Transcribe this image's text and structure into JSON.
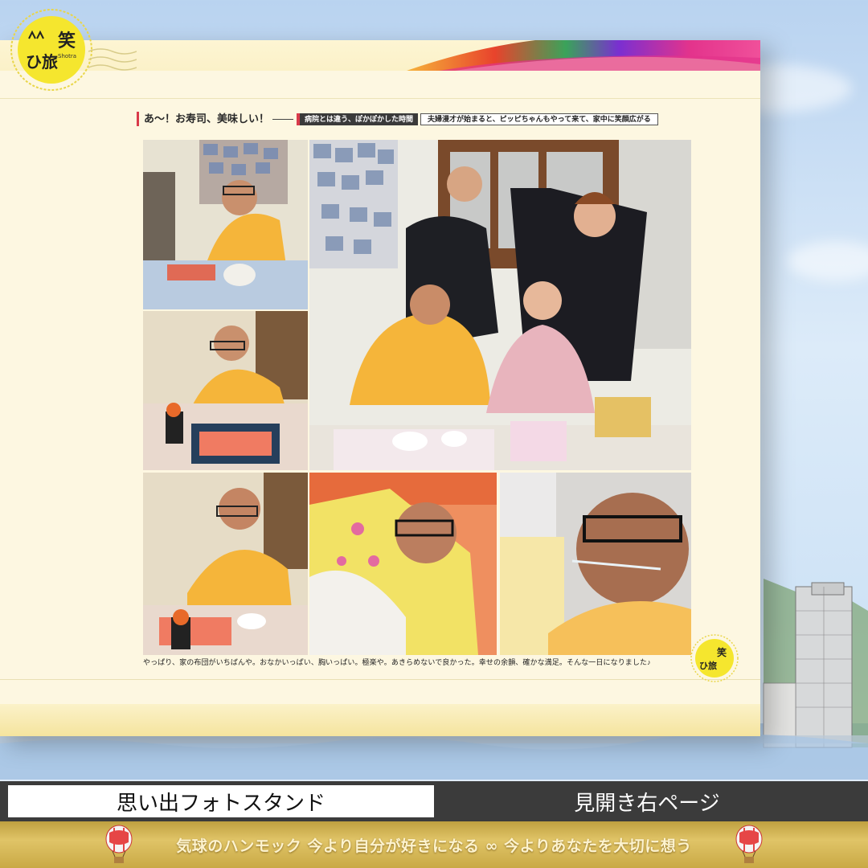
{
  "brand": {
    "logo_text_top": "笑",
    "logo_text_bottom": "ひ旅",
    "logo_sub": "Shotra",
    "accent_yellow": "#f5e62e"
  },
  "page": {
    "heading_title": "あ〜！お寿司、美味しい！",
    "heading_sub": "病院とは違う、ぽかぽかした時間",
    "heading_desc": "夫婦漫才が始まると、ピッピちゃんもやって来て、家中に笑顔広がる",
    "caption": "やっぱり、家の布団がいちばんや。おなかいっぱい、胸いっぱい。極楽や。あきらめないで良かった。幸せの余韻、確かな満足。そんな一日になりました♪"
  },
  "photos": [
    {
      "name": "photo-man-eating-sushi-top"
    },
    {
      "name": "photo-man-eating-sushi-middle"
    },
    {
      "name": "photo-family-group"
    },
    {
      "name": "photo-man-eating-sushi-bottom"
    },
    {
      "name": "photo-man-in-bed"
    },
    {
      "name": "photo-man-resting-closeup"
    }
  ],
  "labels": {
    "left_box": "思い出フォトスタンド",
    "right_label": "見開き右ページ"
  },
  "footer": {
    "text": "気球のハンモック 今より自分が好きになる ∞ 今よりあなたを大切に想う",
    "left_icon": "hot-air-balloon-icon",
    "right_icon": "hot-air-balloon-icon"
  }
}
